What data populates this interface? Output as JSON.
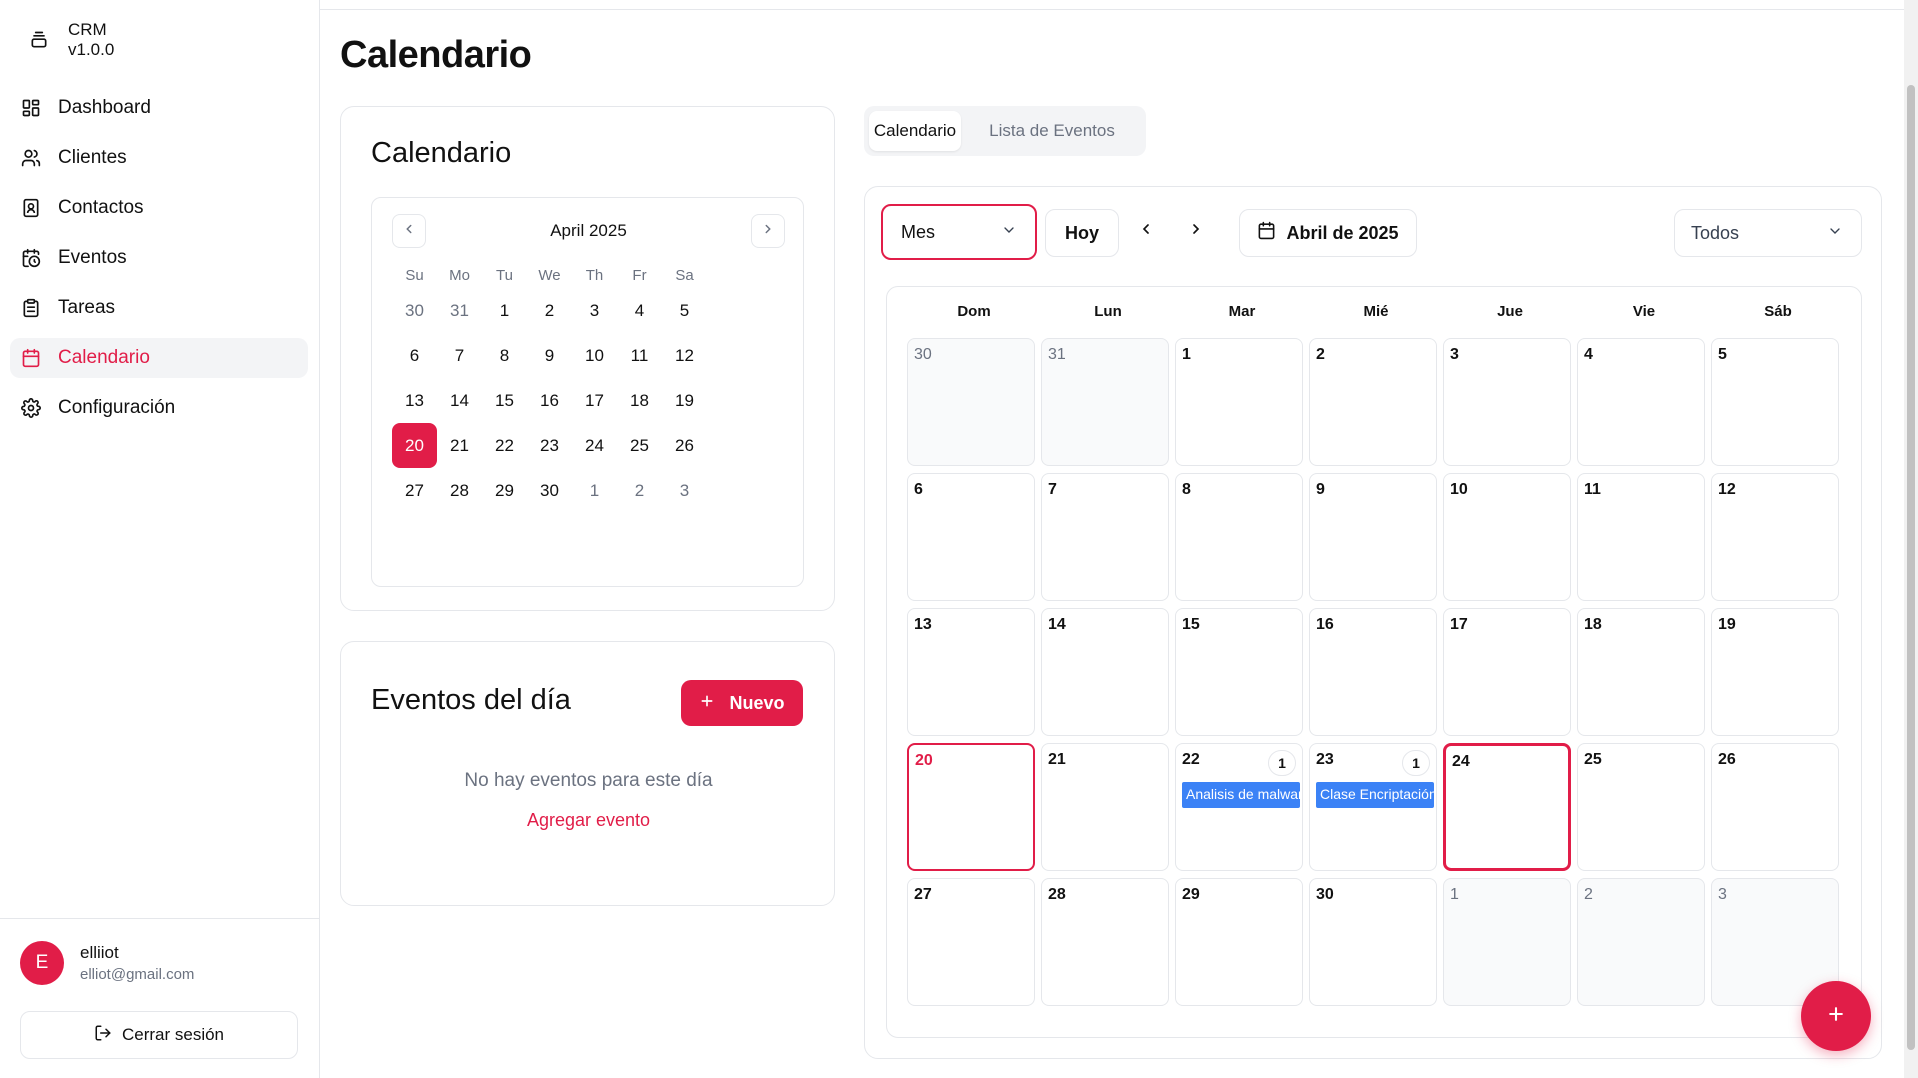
{
  "sidebar": {
    "brand": {
      "name": "CRM",
      "version": "v1.0.0"
    },
    "items": [
      {
        "label": "Dashboard",
        "icon": "grid-icon"
      },
      {
        "label": "Clientes",
        "icon": "users-icon"
      },
      {
        "label": "Contactos",
        "icon": "contact-icon"
      },
      {
        "label": "Eventos",
        "icon": "calendar-clock-icon"
      },
      {
        "label": "Tareas",
        "icon": "clipboard-icon"
      },
      {
        "label": "Calendario",
        "icon": "calendar-icon"
      },
      {
        "label": "Configuración",
        "icon": "gear-icon"
      }
    ],
    "active_item": "Calendario",
    "user": {
      "initial": "E",
      "name": "elliiot",
      "email": "elliot@gmail.com"
    },
    "logout_label": "Cerrar sesión"
  },
  "page": {
    "title": "Calendario"
  },
  "mini_calendar": {
    "heading": "Calendario",
    "month_label": "April 2025",
    "dow": [
      "Su",
      "Mo",
      "Tu",
      "We",
      "Th",
      "Fr",
      "Sa"
    ],
    "days": [
      {
        "d": "30",
        "out": true
      },
      {
        "d": "31",
        "out": true
      },
      {
        "d": "1"
      },
      {
        "d": "2"
      },
      {
        "d": "3"
      },
      {
        "d": "4"
      },
      {
        "d": "5"
      },
      {
        "d": "6"
      },
      {
        "d": "7"
      },
      {
        "d": "8"
      },
      {
        "d": "9"
      },
      {
        "d": "10"
      },
      {
        "d": "11"
      },
      {
        "d": "12"
      },
      {
        "d": "13"
      },
      {
        "d": "14"
      },
      {
        "d": "15"
      },
      {
        "d": "16"
      },
      {
        "d": "17"
      },
      {
        "d": "18"
      },
      {
        "d": "19"
      },
      {
        "d": "20",
        "selected": true
      },
      {
        "d": "21"
      },
      {
        "d": "22"
      },
      {
        "d": "23"
      },
      {
        "d": "24"
      },
      {
        "d": "25"
      },
      {
        "d": "26"
      },
      {
        "d": "27"
      },
      {
        "d": "28"
      },
      {
        "d": "29"
      },
      {
        "d": "30"
      },
      {
        "d": "1",
        "out": true
      },
      {
        "d": "2",
        "out": true
      },
      {
        "d": "3",
        "out": true
      }
    ]
  },
  "day_events": {
    "heading": "Eventos del día",
    "new_button": "Nuevo",
    "empty_text": "No hay eventos para este día",
    "add_link": "Agregar evento"
  },
  "tabs": {
    "calendar": "Calendario",
    "list": "Lista de Eventos",
    "active": "Calendario"
  },
  "toolbar": {
    "view_select": "Mes",
    "today_button": "Hoy",
    "month_label": "Abril de 2025",
    "filter_select": "Todos"
  },
  "month_view": {
    "dow": [
      "Dom",
      "Lun",
      "Mar",
      "Mié",
      "Jue",
      "Vie",
      "Sáb"
    ],
    "cells": [
      {
        "d": "30",
        "out": true
      },
      {
        "d": "31",
        "out": true
      },
      {
        "d": "1"
      },
      {
        "d": "2"
      },
      {
        "d": "3"
      },
      {
        "d": "4"
      },
      {
        "d": "5"
      },
      {
        "d": "6"
      },
      {
        "d": "7"
      },
      {
        "d": "8"
      },
      {
        "d": "9"
      },
      {
        "d": "10"
      },
      {
        "d": "11"
      },
      {
        "d": "12"
      },
      {
        "d": "13"
      },
      {
        "d": "14"
      },
      {
        "d": "15"
      },
      {
        "d": "16"
      },
      {
        "d": "17"
      },
      {
        "d": "18"
      },
      {
        "d": "19"
      },
      {
        "d": "20",
        "today": true
      },
      {
        "d": "21"
      },
      {
        "d": "22",
        "count": "1",
        "event": "Analisis de malware"
      },
      {
        "d": "23",
        "count": "1",
        "event": "Clase Encriptación"
      },
      {
        "d": "24",
        "selected": true
      },
      {
        "d": "25"
      },
      {
        "d": "26"
      },
      {
        "d": "27"
      },
      {
        "d": "28"
      },
      {
        "d": "29"
      },
      {
        "d": "30"
      },
      {
        "d": "1",
        "out": true
      },
      {
        "d": "2",
        "out": true
      },
      {
        "d": "3",
        "out": true
      }
    ]
  },
  "colors": {
    "accent": "#e11d48",
    "event": "#3b82f6"
  }
}
